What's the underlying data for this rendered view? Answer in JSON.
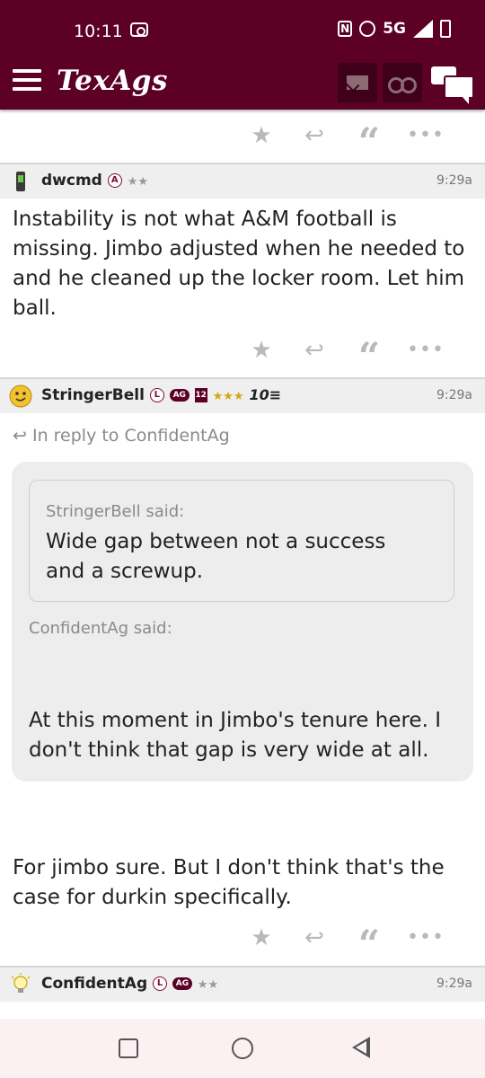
{
  "status_bar": {
    "time": "10:11",
    "network": "5G"
  },
  "app_bar": {
    "logo": "TexAgs",
    "icons": [
      "menu-icon",
      "mail-icon",
      "binoculars-icon",
      "chat-icon"
    ]
  },
  "post_actions": {
    "star": "★",
    "reply": "↩",
    "quote": "“",
    "more": "•••"
  },
  "posts": [
    {
      "username": "dwcmd",
      "badge_letter": "A",
      "stars": "★★",
      "time": "9:29a",
      "body": "Instability is not what A&M football is missing. Jimbo adjusted when he needed to and he cleaned up the locker room. Let him ball."
    },
    {
      "username": "StringerBell",
      "badge_letter": "L",
      "badge_ag": "AG",
      "badge_number": "12",
      "stars": "★★★",
      "badge_extra": "10≡",
      "time": "9:29a",
      "in_reply_to": "In reply to ConfidentAg",
      "nested_quote_author": "StringerBell said:",
      "nested_quote_text": "Wide gap between not a success and a screwup.",
      "quote_author": "ConfidentAg said:",
      "quote_text": "At this moment in Jimbo's tenure here. I don't think that gap is very wide at all.",
      "body": "For jimbo sure. But I don't think that's the case for durkin specifically."
    },
    {
      "username": "ConfidentAg",
      "badge_letter": "L",
      "badge_ag": "AG",
      "stars": "★★",
      "time": "9:29a"
    }
  ],
  "nav_bar": {
    "icons": [
      "recents-icon",
      "home-icon",
      "back-icon"
    ]
  }
}
